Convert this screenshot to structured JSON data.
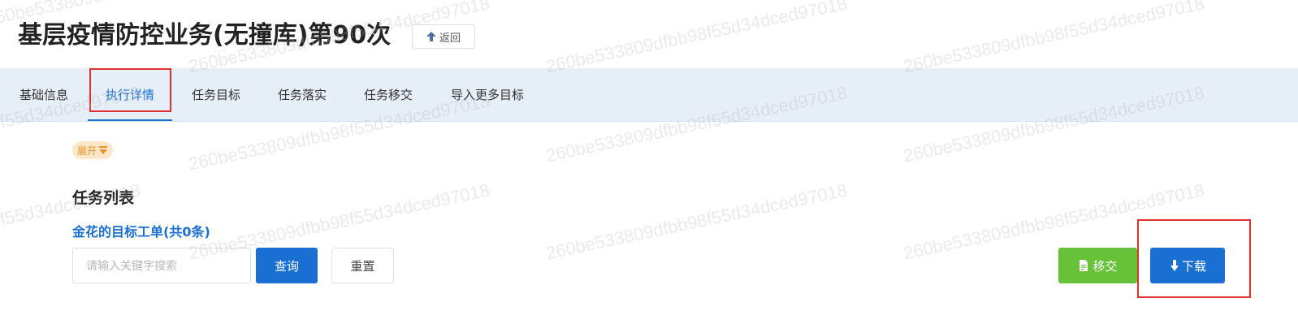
{
  "header": {
    "title": "基层疫情防控业务(无撞库)第90次",
    "back_label": "返回"
  },
  "tabs": [
    {
      "label": "基础信息",
      "active": false
    },
    {
      "label": "执行详情",
      "active": true
    },
    {
      "label": "任务目标",
      "active": false
    },
    {
      "label": "任务落实",
      "active": false
    },
    {
      "label": "任务移交",
      "active": false
    },
    {
      "label": "导入更多目标",
      "active": false
    }
  ],
  "expand_label": "展开",
  "section": {
    "title": "任务列表",
    "subtitle": "金花的目标工单(共0条)"
  },
  "search": {
    "placeholder": "请输入关键字搜索",
    "value": ""
  },
  "buttons": {
    "query": "查询",
    "reset": "重置",
    "transfer": "移交",
    "download": "下载"
  },
  "watermark_text": "260be533809dfbb98f55d34dced97018",
  "colors": {
    "primary": "#1a6fd3",
    "success": "#67c23a",
    "tab_bar_bg": "#e6eef8",
    "highlight_box": "#e03131",
    "badge_bg": "#fde7c8",
    "badge_text": "#e8902a"
  },
  "icons": {
    "back": "upload-arrow-icon",
    "expand": "caret-down-icon",
    "transfer": "document-icon",
    "download": "arrow-down-icon"
  }
}
